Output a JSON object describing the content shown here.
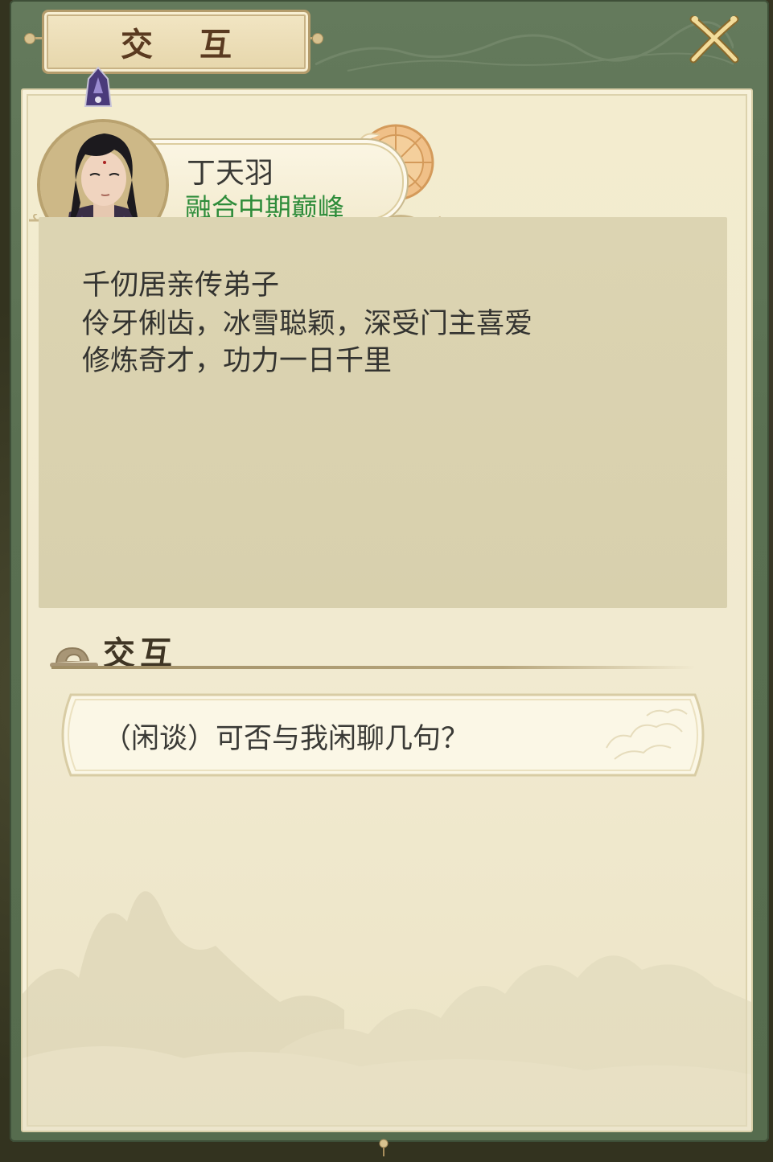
{
  "window": {
    "title": "交 互",
    "close_icon": "close-x-icon"
  },
  "character": {
    "name": "丁天羽",
    "realm": "融合中期巅峰",
    "realm_color": "#2e8c3a",
    "avatar_icon": "character-portrait"
  },
  "description": {
    "lines": [
      "千仞居亲传弟子",
      "伶牙俐齿，冰雪聪颖，深受门主喜爱",
      "修炼奇才，功力一日千里"
    ]
  },
  "interaction": {
    "section_title": "交互",
    "section_icon": "cloud-scroll-icon",
    "options": [
      {
        "label": "（闲谈）可否与我闲聊几句？"
      }
    ]
  },
  "colors": {
    "frame_green": "#5a7052",
    "parchment": "#f1ead0",
    "title_brown": "#5a3a20"
  }
}
